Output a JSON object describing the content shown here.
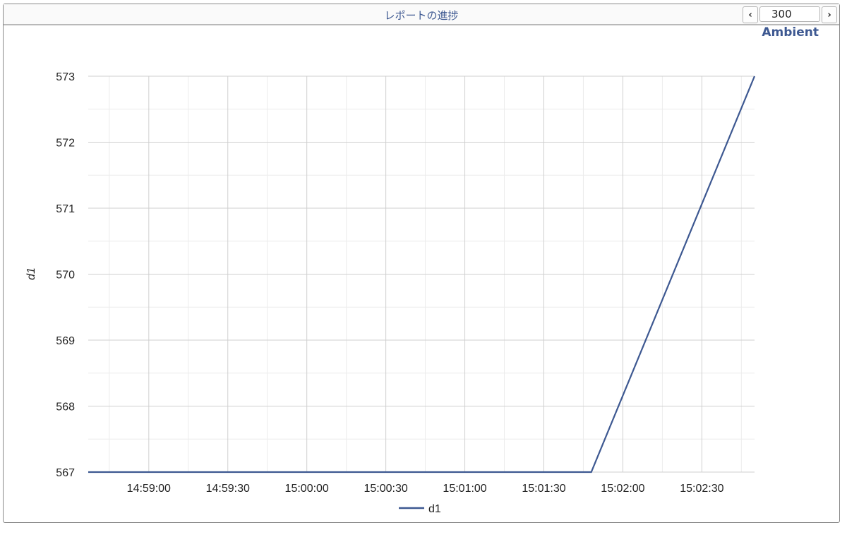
{
  "header": {
    "title": "レポートの進捗",
    "page_value": "300",
    "prev_icon": "chevron-left-icon",
    "next_icon": "chevron-right-icon"
  },
  "brand": {
    "label": "Ambient",
    "color": "#3d5891"
  },
  "chart_data": {
    "type": "line",
    "title": "",
    "xlabel": "",
    "ylabel": "d1",
    "x_ticks": [
      "14:59:00",
      "14:59:30",
      "15:00:00",
      "15:00:30",
      "15:01:00",
      "15:01:30",
      "15:02:00",
      "15:02:30"
    ],
    "y_ticks": [
      "567",
      "568",
      "569",
      "570",
      "571",
      "572",
      "573"
    ],
    "xlim": [
      "14:58:37",
      "15:02:50"
    ],
    "ylim": [
      567,
      573
    ],
    "grid": true,
    "legend": "bottom-center",
    "series": [
      {
        "name": "d1",
        "color": "#3d5891",
        "points": [
          {
            "x": "14:58:37",
            "y": 567
          },
          {
            "x": "15:01:48",
            "y": 567
          },
          {
            "x": "15:02:50",
            "y": 573
          }
        ]
      }
    ]
  }
}
